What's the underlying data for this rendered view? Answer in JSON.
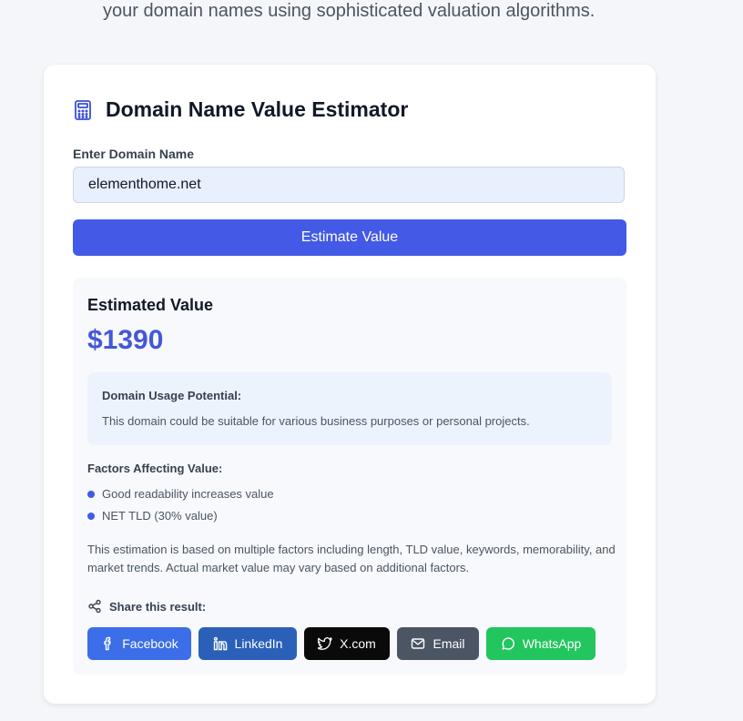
{
  "intro": {
    "text": "your domain names using sophisticated valuation algorithms."
  },
  "card": {
    "title": "Domain Name Value Estimator",
    "icon": "calculator-icon",
    "domain_label": "Enter Domain Name",
    "domain_value": "elementhome.net",
    "estimate_button": "Estimate Value"
  },
  "result": {
    "heading": "Estimated Value",
    "value": "$1390",
    "usage_title": "Domain Usage Potential:",
    "usage_text": "This domain could be suitable for various business purposes or personal projects.",
    "factors_title": "Factors Affecting Value:",
    "factors": [
      "Good readability increases value",
      "NET TLD (30% value)"
    ],
    "note": "This estimation is based on multiple factors including length, TLD value, keywords, memorability, and market trends. Actual market value may vary based on additional factors.",
    "share_label": "Share this result:",
    "share_buttons": [
      {
        "label": "Facebook",
        "icon": "facebook-icon",
        "color": "#3b6ee8"
      },
      {
        "label": "LinkedIn",
        "icon": "linkedin-icon",
        "color": "#2a60b8"
      },
      {
        "label": "X.com",
        "icon": "twitter-icon",
        "color": "#0a0a0a"
      },
      {
        "label": "Email",
        "icon": "mail-icon",
        "color": "#4b5563"
      },
      {
        "label": "WhatsApp",
        "icon": "whatsapp-icon",
        "color": "#22c55e"
      }
    ]
  },
  "colors": {
    "accent": "#435ae6",
    "value": "#4358d8",
    "background": "#f5f6f9"
  }
}
